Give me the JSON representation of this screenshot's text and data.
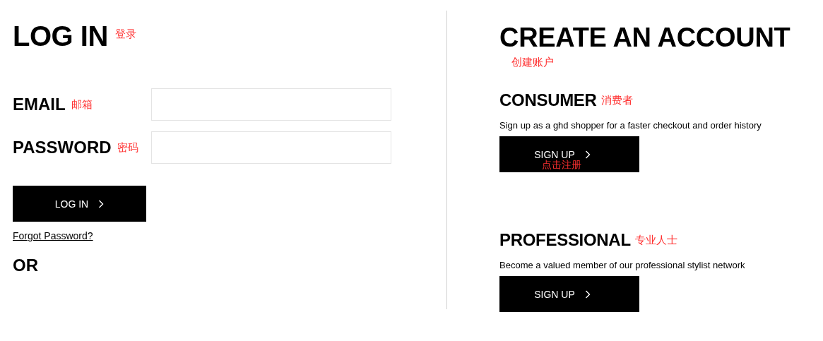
{
  "login": {
    "title": "LOG IN",
    "title_note": "登录",
    "fields": [
      {
        "label": "EMAIL",
        "note": "邮箱"
      },
      {
        "label": "PASSWORD",
        "note": "密码"
      }
    ],
    "button": "LOG IN",
    "forgot_link": "Forgot Password?",
    "or": "OR"
  },
  "create": {
    "title": "CREATE AN ACCOUNT",
    "title_note": "创建账户",
    "sections": [
      {
        "title": "CONSUMER",
        "note": "消费者",
        "description": "Sign up as a ghd shopper for a faster checkout and order history",
        "button": "SIGN UP",
        "button_note": "点击注册"
      },
      {
        "title": "PROFESSIONAL",
        "note": "专业人士",
        "description": "Become a valued member of our professional stylist network",
        "button": "SIGN UP"
      }
    ]
  }
}
